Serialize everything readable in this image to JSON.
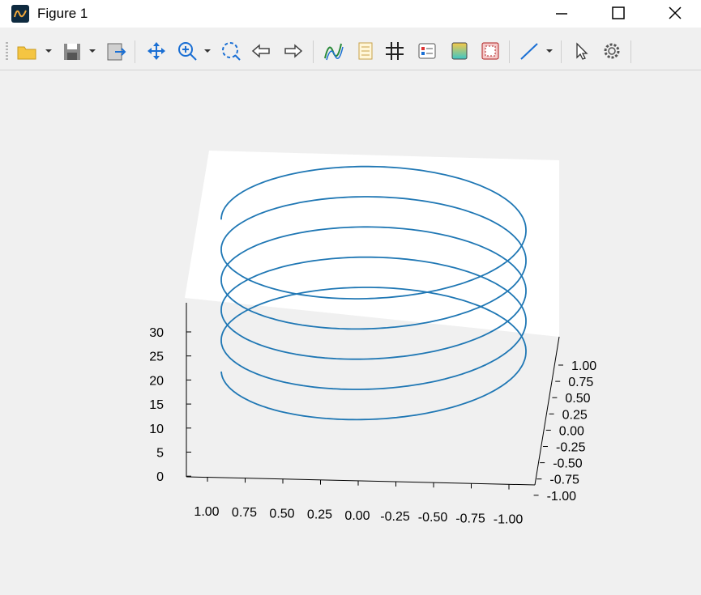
{
  "window": {
    "title": "Figure 1"
  },
  "toolbar": {
    "buttons": [
      "open-file",
      "save",
      "export",
      "pan",
      "zoom",
      "zoom-fit",
      "back",
      "forward",
      "curve-fit",
      "legend",
      "grid",
      "axes-editor",
      "colormap",
      "layout",
      "line-style",
      "select",
      "settings"
    ]
  },
  "chart_data": {
    "type": "line",
    "projection": "3d",
    "series": [
      {
        "color": "#1f77b4",
        "x_formula": "cos(t)",
        "y_formula": "sin(t)",
        "z_formula": "t",
        "t_range": [
          0,
          31.4
        ]
      }
    ],
    "x_ticks": [
      "1.00",
      "0.75",
      "0.50",
      "0.25",
      "0.00",
      "-0.25",
      "-0.50",
      "-0.75",
      "-1.00"
    ],
    "y_ticks": [
      "1.00",
      "0.75",
      "0.50",
      "0.25",
      "0.00",
      "-0.25",
      "-0.50",
      "-0.75",
      "-1.00"
    ],
    "z_ticks": [
      "30",
      "25",
      "20",
      "15",
      "10",
      "5",
      "0"
    ],
    "xlim": [
      -1,
      1
    ],
    "ylim": [
      -1,
      1
    ],
    "zlim": [
      0,
      31.4
    ],
    "xlabel": "",
    "ylabel": "",
    "zlabel": "",
    "grid": false,
    "colors": {
      "line": "#1f77b4",
      "pane": "#ffffff",
      "background": "#f0f0f0"
    }
  }
}
